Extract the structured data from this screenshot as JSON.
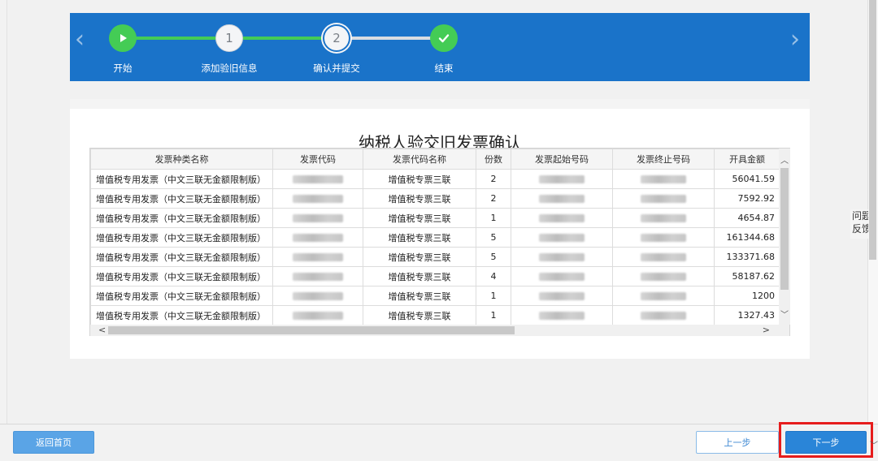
{
  "stepper": {
    "steps": [
      {
        "label": "开始",
        "marker": "play-icon",
        "state": "done"
      },
      {
        "label": "添加验旧信息",
        "marker": "1",
        "state": "done"
      },
      {
        "label": "确认并提交",
        "marker": "2",
        "state": "current"
      },
      {
        "label": "结束",
        "marker": "check-icon",
        "state": "pending"
      }
    ],
    "prev_arrow": "‹",
    "next_arrow": "›"
  },
  "page_title": "纳税人验交旧发票确认",
  "table": {
    "columns": [
      "发票种类名称",
      "发票代码",
      "发票代码名称",
      "份数",
      "发票起始号码",
      "发票终止号码",
      "开具金额"
    ],
    "rows": [
      {
        "type": "增值税专用发票（中文三联无金额限制版）",
        "code_name": "增值税专票三联",
        "count": "2",
        "amount": "56041.59"
      },
      {
        "type": "增值税专用发票（中文三联无金额限制版）",
        "code_name": "增值税专票三联",
        "count": "2",
        "amount": "7592.92"
      },
      {
        "type": "增值税专用发票（中文三联无金额限制版）",
        "code_name": "增值税专票三联",
        "count": "1",
        "amount": "4654.87"
      },
      {
        "type": "增值税专用发票（中文三联无金额限制版）",
        "code_name": "增值税专票三联",
        "count": "5",
        "amount": "161344.68"
      },
      {
        "type": "增值税专用发票（中文三联无金额限制版）",
        "code_name": "增值税专票三联",
        "count": "5",
        "amount": "133371.68"
      },
      {
        "type": "增值税专用发票（中文三联无金额限制版）",
        "code_name": "增值税专票三联",
        "count": "4",
        "amount": "58187.62"
      },
      {
        "type": "增值税专用发票（中文三联无金额限制版）",
        "code_name": "增值税专票三联",
        "count": "1",
        "amount": "1200"
      },
      {
        "type": "增值税专用发票（中文三联无金额限制版）",
        "code_name": "增值税专票三联",
        "count": "1",
        "amount": "1327.43"
      }
    ]
  },
  "feedback_label": "问题反馈",
  "footer": {
    "home_label": "返回首页",
    "prev_label": "上一步",
    "next_label": "下一步"
  },
  "colors": {
    "banner": "#1a73c9",
    "step_done": "#44cc55",
    "highlight": "#e61c1c"
  }
}
